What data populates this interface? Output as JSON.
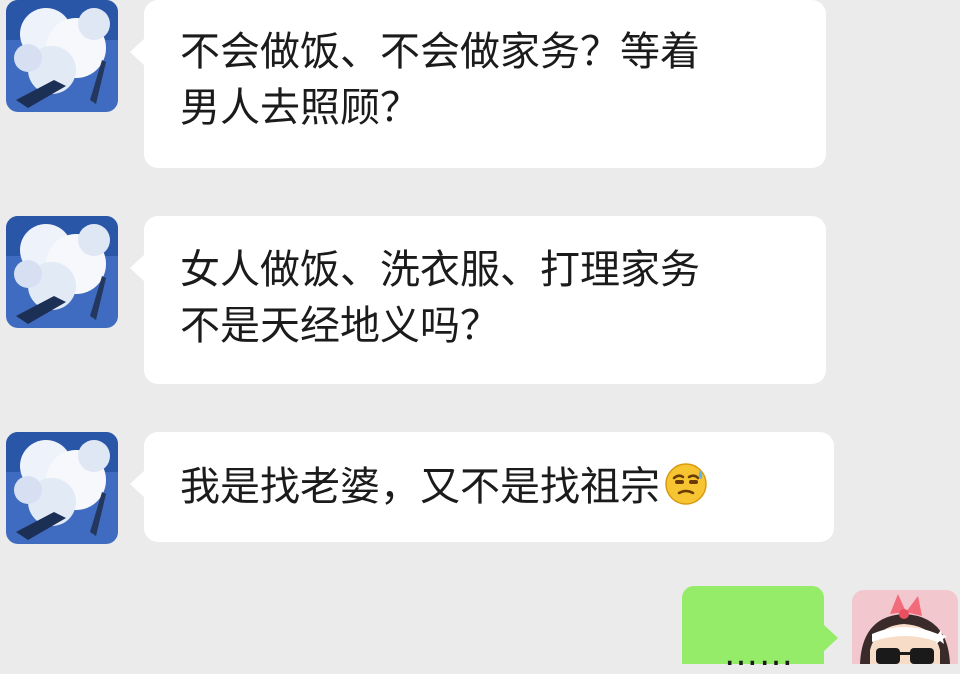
{
  "messages": [
    {
      "side": "left",
      "avatar": "cloud-avatar",
      "lines": [
        "不会做饭、不会做家务？等着",
        "男人去照顾？"
      ]
    },
    {
      "side": "left",
      "avatar": "cloud-avatar",
      "lines": [
        "女人做饭、洗衣服、打理家务",
        "不是天经地义吗？"
      ]
    },
    {
      "side": "left",
      "avatar": "cloud-avatar",
      "lines": [
        "我是找老婆，又不是找祖宗"
      ],
      "emoji": "sweat-smile-emoji"
    }
  ],
  "reply": {
    "side": "right",
    "avatar": "cartoon-girl-avatar",
    "text": "……"
  },
  "colors": {
    "background": "#ebebeb",
    "incoming_bubble": "#ffffff",
    "outgoing_bubble": "#95ec69"
  }
}
